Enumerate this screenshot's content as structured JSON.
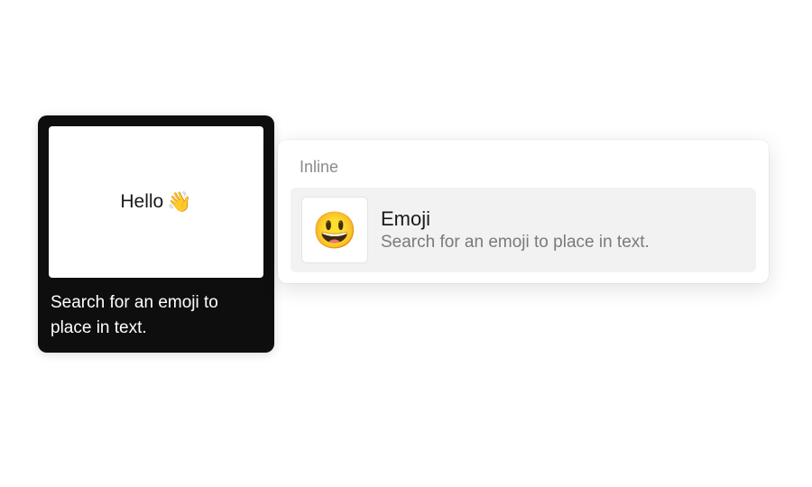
{
  "tooltip": {
    "preview_text": "Hello",
    "preview_emoji": "👋",
    "caption": "Search for an emoji to place in text."
  },
  "menu": {
    "section_label": "Inline",
    "item": {
      "icon_emoji": "😃",
      "title": "Emoji",
      "description": "Search for an emoji to place in text."
    }
  }
}
